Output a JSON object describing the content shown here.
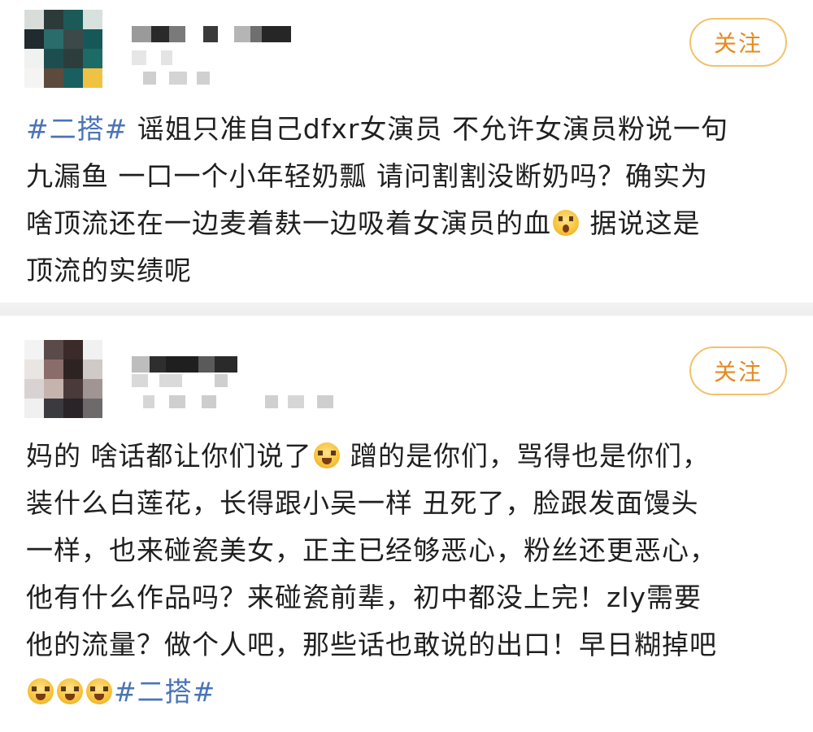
{
  "posts": [
    {
      "follow_label": "关注",
      "avatar_icon": "pixelated-avatar",
      "lines": [
        [
          {
            "t": "#二搭#",
            "tag": true
          },
          {
            "t": " 谣姐只准自己dfxr女演员 不允许女演员粉说一句"
          }
        ],
        [
          {
            "t": "九漏鱼 一口一个小年轻奶瓢 请问割割没断奶吗？确实为"
          }
        ],
        [
          {
            "t": "啥顶流还在一边麦着麸一边吸着女演员的血"
          },
          {
            "emoji": "shock"
          },
          {
            "t": " 据说这是"
          }
        ],
        [
          {
            "t": "顶流的实绩呢"
          }
        ]
      ]
    },
    {
      "follow_label": "关注",
      "avatar_icon": "pixelated-avatar",
      "lines": [
        [
          {
            "t": "妈的 啥话都让你们说了"
          },
          {
            "emoji": "cry"
          },
          {
            "t": " 蹭的是你们，骂得也是你们，"
          }
        ],
        [
          {
            "t": "装什么白莲花，长得跟小吴一样 丑死了，脸跟发面馒头"
          }
        ],
        [
          {
            "t": "一样，也来碰瓷美女，正主已经够恶心，粉丝还更恶心，"
          }
        ],
        [
          {
            "t": "他有什么作品吗？来碰瓷前辈，初中都没上完！zly需要"
          }
        ],
        [
          {
            "t": "他的流量？做个人吧，那些话也敢说的出口！早日糊掉吧"
          }
        ],
        [
          {
            "emoji": "cry"
          },
          {
            "emoji": "cry"
          },
          {
            "emoji": "cry"
          },
          {
            "t": "#二搭#",
            "tag": true
          }
        ]
      ]
    }
  ],
  "colors": {
    "tag": "#4a74b6",
    "follow_text": "#e58a1f",
    "follow_border": "#f2c26b"
  }
}
